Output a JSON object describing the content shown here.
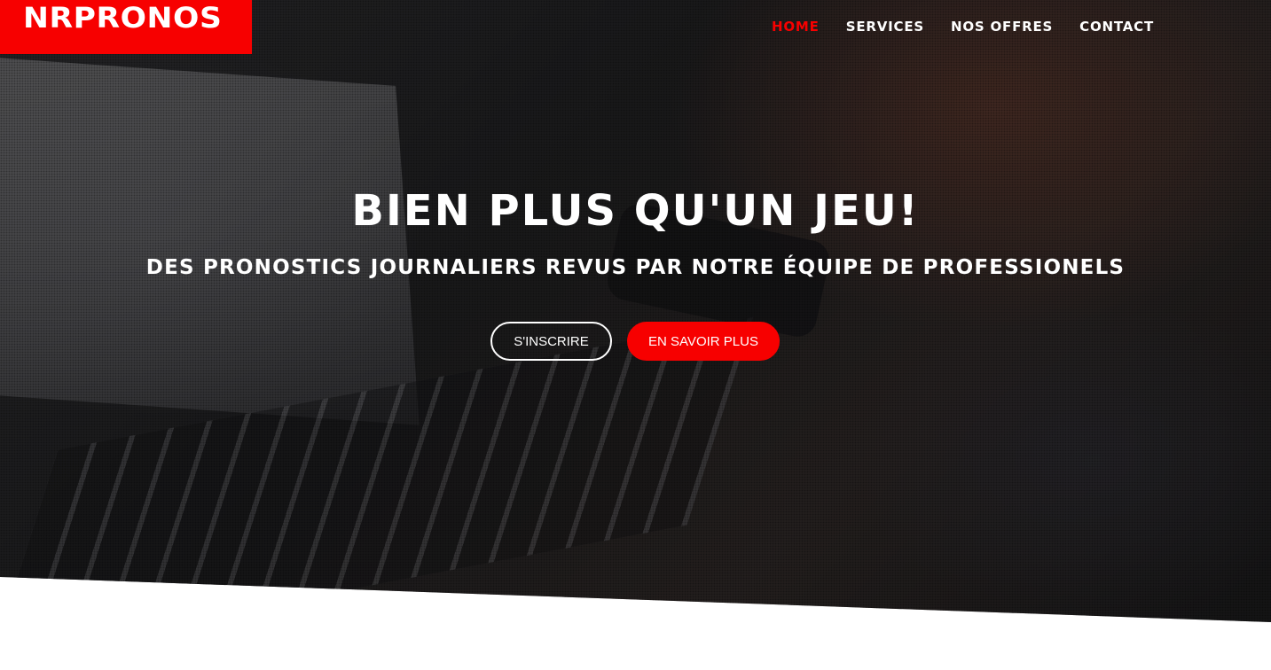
{
  "brand": {
    "logo_text": "NRPRONOS",
    "accent_color": "#f70000"
  },
  "nav": {
    "items": [
      {
        "label": "HOME",
        "active": true
      },
      {
        "label": "SERVICES",
        "active": false
      },
      {
        "label": "NOS OFFRES",
        "active": false
      },
      {
        "label": "CONTACT",
        "active": false
      }
    ]
  },
  "hero": {
    "title": "BIEN PLUS QU'UN JEU!",
    "subtitle": "DES PRONOSTICS JOURNALIERS REVUS PAR NOTRE ÉQUIPE DE PROFESSIONELS",
    "buttons": {
      "signup_label": "S'INSCRIRE",
      "learn_more_label": "EN SAVOIR PLUS"
    }
  }
}
